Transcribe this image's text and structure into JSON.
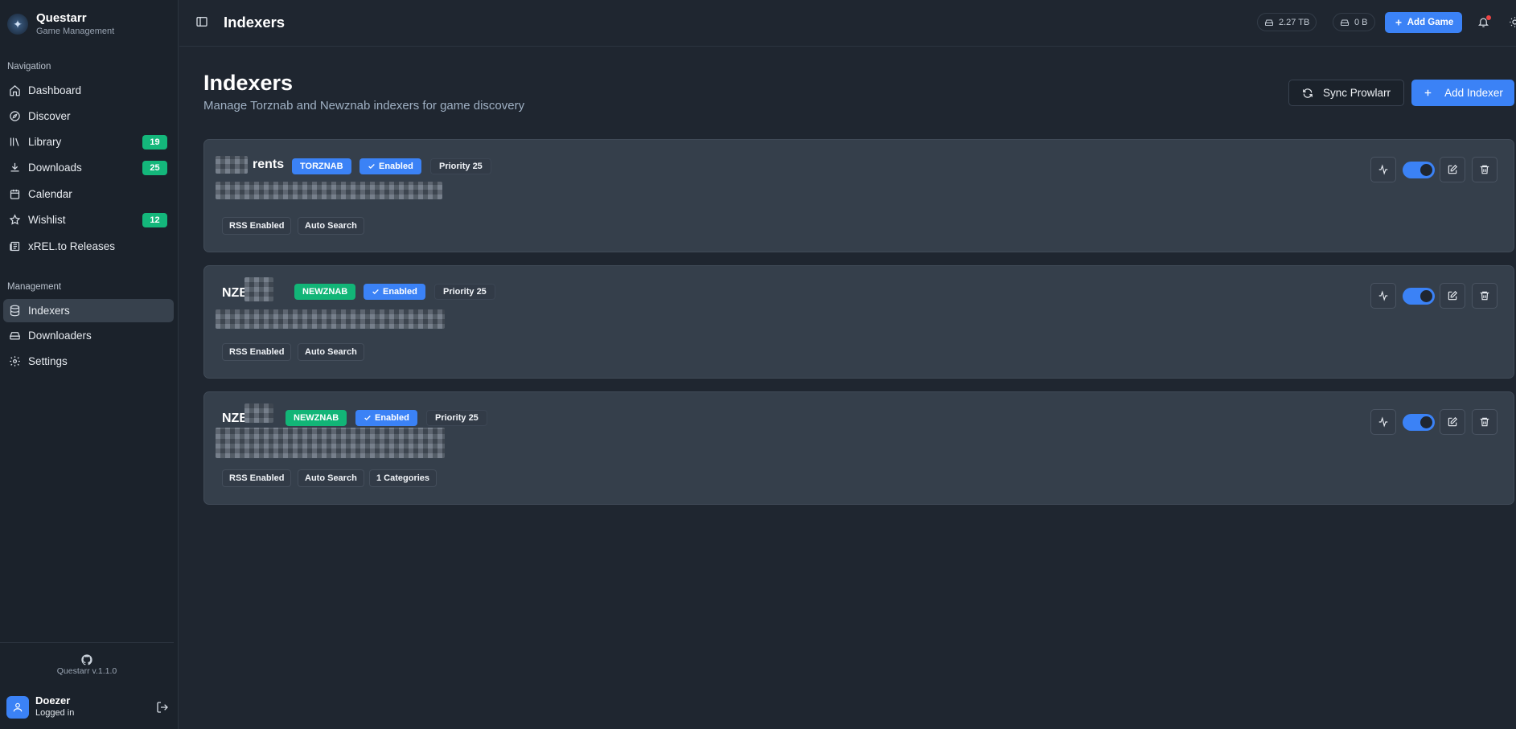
{
  "brand": {
    "name": "Questarr",
    "subtitle": "Game Management"
  },
  "sidebar": {
    "sections": {
      "navigation": "Navigation",
      "management": "Management"
    },
    "nav": [
      {
        "label": "Dashboard",
        "icon": "home-icon"
      },
      {
        "label": "Discover",
        "icon": "compass-icon"
      },
      {
        "label": "Library",
        "icon": "library-icon",
        "badge": "19"
      },
      {
        "label": "Downloads",
        "icon": "download-icon",
        "badge": "25"
      },
      {
        "label": "Calendar",
        "icon": "calendar-icon"
      },
      {
        "label": "Wishlist",
        "icon": "star-icon",
        "badge": "12"
      },
      {
        "label": "xREL.to Releases",
        "icon": "newspaper-icon"
      }
    ],
    "management": [
      {
        "label": "Indexers",
        "icon": "database-icon",
        "active": true
      },
      {
        "label": "Downloaders",
        "icon": "hard-drive-icon"
      },
      {
        "label": "Settings",
        "icon": "gear-icon"
      }
    ],
    "version": "Questarr v.1.1.0",
    "user": {
      "name": "Doezer",
      "status": "Logged in"
    }
  },
  "header": {
    "title": "Indexers",
    "storage": "2.27 TB",
    "download_size": "0 B",
    "add_game": "Add Game"
  },
  "page": {
    "title": "Indexers",
    "subtitle": "Manage Torznab and Newznab indexers for game discovery",
    "sync_button": "Sync Prowlarr",
    "add_button": "Add Indexer"
  },
  "indexers": [
    {
      "name": "rents",
      "type": "TORZNAB",
      "status": "Enabled",
      "priority": "Priority 25",
      "tags": [
        "RSS Enabled",
        "Auto Search"
      ],
      "enabled": true
    },
    {
      "name": "NZB",
      "type": "NEWZNAB",
      "status": "Enabled",
      "priority": "Priority 25",
      "tags": [
        "RSS Enabled",
        "Auto Search"
      ],
      "enabled": true
    },
    {
      "name": "NZB",
      "type": "NEWZNAB",
      "status": "Enabled",
      "priority": "Priority 25",
      "tags": [
        "RSS Enabled",
        "Auto Search",
        "1 Categories"
      ],
      "enabled": true
    }
  ],
  "colors": {
    "accent": "#3b82f6",
    "success": "#12b577",
    "background": "#1f2630",
    "card": "#353f4b"
  }
}
